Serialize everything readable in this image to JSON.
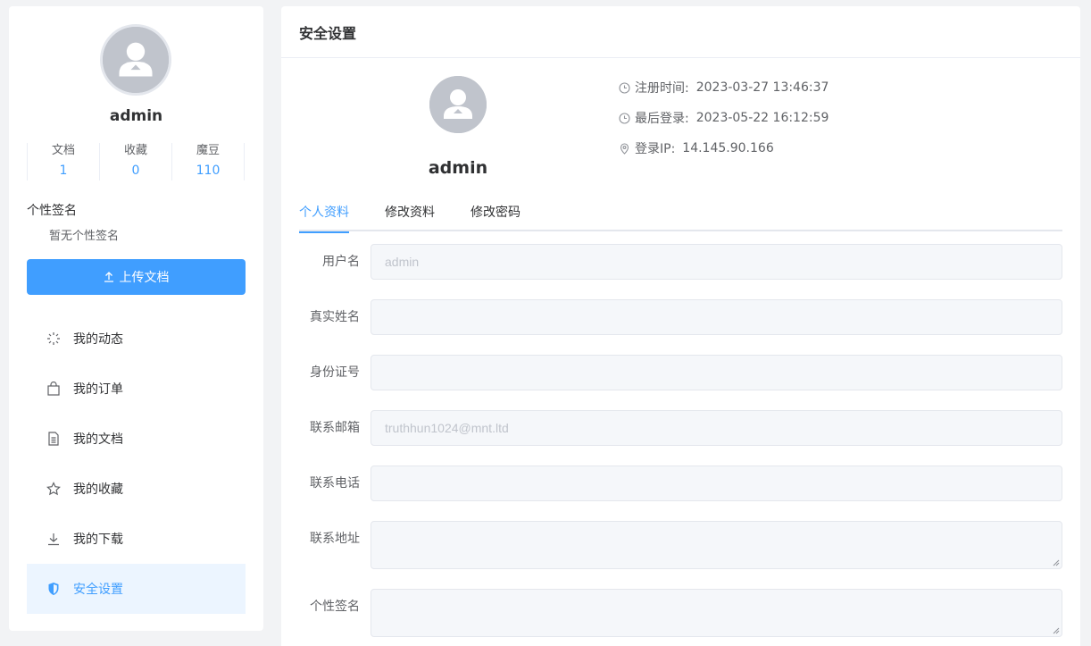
{
  "left": {
    "username": "admin",
    "stats": [
      {
        "label": "文档",
        "value": "1"
      },
      {
        "label": "收藏",
        "value": "0"
      },
      {
        "label": "魔豆",
        "value": "110"
      }
    ],
    "signature_title": "个性签名",
    "signature_text": "暂无个性签名",
    "upload_label": "上传文档",
    "menu": [
      {
        "label": "我的动态",
        "icon": "loading-icon"
      },
      {
        "label": "我的订单",
        "icon": "shopping-bag-icon"
      },
      {
        "label": "我的文档",
        "icon": "document-icon"
      },
      {
        "label": "我的收藏",
        "icon": "star-icon"
      },
      {
        "label": "我的下载",
        "icon": "download-icon"
      },
      {
        "label": "安全设置",
        "icon": "shield-icon",
        "active": true
      }
    ]
  },
  "right": {
    "title": "安全设置",
    "username": "admin",
    "info": {
      "register_label": "注册时间:",
      "register_value": "2023-03-27 13:46:37",
      "last_login_label": "最后登录:",
      "last_login_value": "2023-05-22 16:12:59",
      "ip_label": "登录IP:",
      "ip_value": "14.145.90.166"
    },
    "tabs": [
      {
        "label": "个人资料",
        "active": true
      },
      {
        "label": "修改资料"
      },
      {
        "label": "修改密码"
      }
    ],
    "form": {
      "username_label": "用户名",
      "username_value": "admin",
      "realname_label": "真实姓名",
      "realname_value": "",
      "idcard_label": "身份证号",
      "idcard_value": "",
      "email_label": "联系邮箱",
      "email_value": "truthhun1024@mnt.ltd",
      "phone_label": "联系电话",
      "phone_value": "",
      "address_label": "联系地址",
      "address_value": "",
      "signature_label": "个性签名",
      "signature_value": ""
    }
  },
  "colors": {
    "accent": "#409eff",
    "active_bg": "#ecf5ff",
    "input_bg": "#f5f7fa"
  }
}
